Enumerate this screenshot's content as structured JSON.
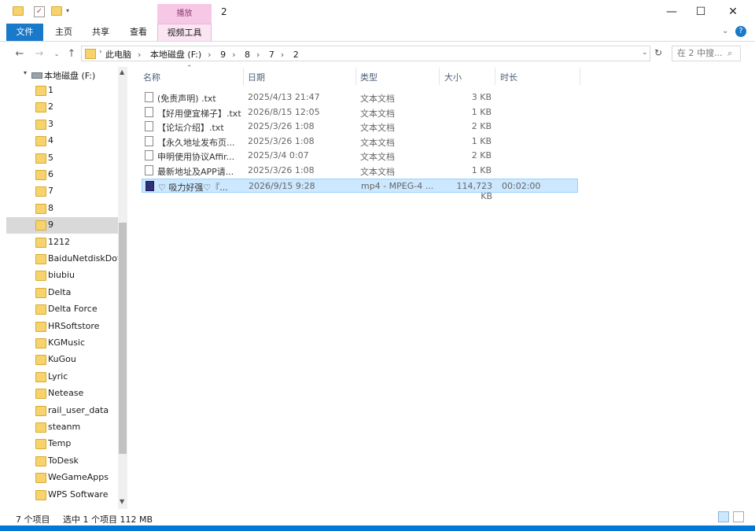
{
  "window": {
    "title": "2",
    "context_tab_label": "播放",
    "controls": {
      "minimize": "—",
      "maximize": "☐",
      "close": "✕"
    }
  },
  "ribbon": {
    "tabs": [
      "文件",
      "主页",
      "共享",
      "查看",
      "视频工具"
    ]
  },
  "address": {
    "crumbs": [
      "此电脑",
      "本地磁盘 (F:)",
      "9",
      "8",
      "7",
      "2"
    ],
    "search_placeholder": "在 2 中搜..."
  },
  "nav_pane": {
    "drive": "本地磁盘 (F:)",
    "items": [
      "1",
      "2",
      "3",
      "4",
      "5",
      "6",
      "7",
      "8",
      "9",
      "1212",
      "BaiduNetdiskDov",
      "biubiu",
      "Delta",
      "Delta Force",
      "HRSoftstore",
      "KGMusic",
      "KuGou",
      "Lyric",
      "Netease",
      "rail_user_data",
      "steanm",
      "Temp",
      "ToDesk",
      "WeGameApps",
      "WPS Software"
    ],
    "selected": "9"
  },
  "columns": [
    "名称",
    "日期",
    "类型",
    "大小",
    "时长"
  ],
  "files": [
    {
      "name": "(免责声明) .txt",
      "date": "2025/4/13 21:47",
      "type": "文本文档",
      "size": "3 KB",
      "length": ""
    },
    {
      "name": "【好用便宜梯子】.txt",
      "date": "2026/8/15 12:05",
      "type": "文本文档",
      "size": "1 KB",
      "length": ""
    },
    {
      "name": "【论坛介绍】.txt",
      "date": "2025/3/26 1:08",
      "type": "文本文档",
      "size": "2 KB",
      "length": ""
    },
    {
      "name": "【永久地址发布页...",
      "date": "2025/3/26 1:08",
      "type": "文本文档",
      "size": "1 KB",
      "length": ""
    },
    {
      "name": "申明使用协议Affir...",
      "date": "2025/3/4 0:07",
      "type": "文本文档",
      "size": "2 KB",
      "length": ""
    },
    {
      "name": "最新地址及APP请...",
      "date": "2025/3/26 1:08",
      "type": "文本文档",
      "size": "1 KB",
      "length": ""
    },
    {
      "name": "♡ 吸力好强♡『...",
      "date": "2026/9/15 9:28",
      "type": "mp4 - MPEG-4 ...",
      "size": "114,723 KB",
      "length": "00:02:00"
    }
  ],
  "status": {
    "count": "7 个项目",
    "selection": "选中 1 个项目  112 MB"
  },
  "colors": {
    "accent": "#0078d7",
    "file_tab": "#1979ca",
    "context_tab": "#f7c8e6",
    "selection": "#cce8ff"
  }
}
